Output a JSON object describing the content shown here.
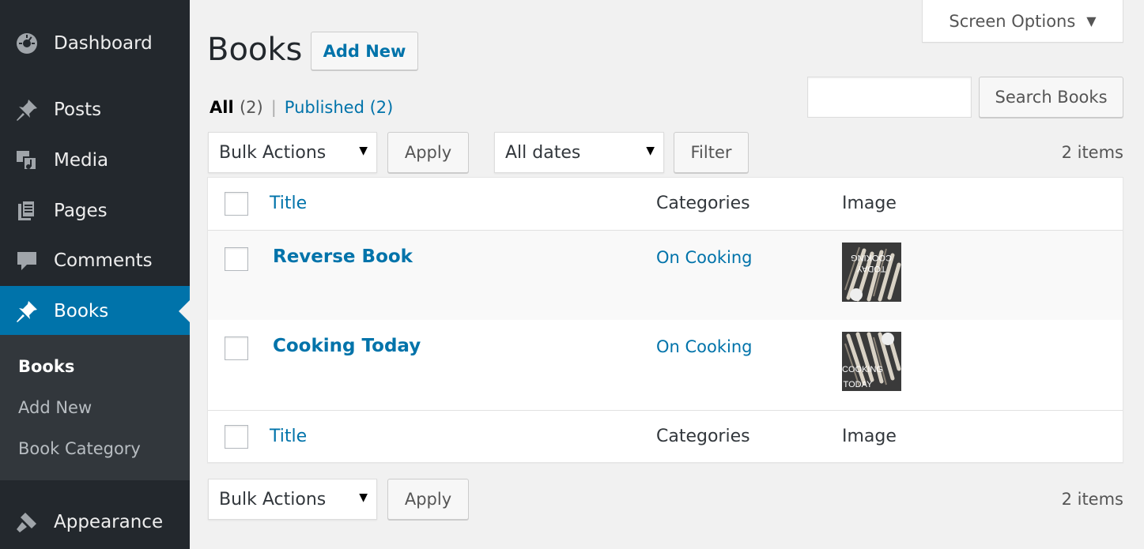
{
  "sidebar": {
    "items": [
      {
        "label": "Dashboard",
        "icon": "dashboard-icon"
      },
      {
        "label": "Posts",
        "icon": "pin-icon"
      },
      {
        "label": "Media",
        "icon": "media-icon"
      },
      {
        "label": "Pages",
        "icon": "pages-icon"
      },
      {
        "label": "Comments",
        "icon": "comment-icon"
      },
      {
        "label": "Books",
        "icon": "pin-icon"
      },
      {
        "label": "Appearance",
        "icon": "brush-icon"
      }
    ],
    "submenu": [
      {
        "label": "Books"
      },
      {
        "label": "Add New"
      },
      {
        "label": "Book Category"
      }
    ]
  },
  "screen_options": {
    "label": "Screen Options",
    "caret": "▼"
  },
  "header": {
    "title": "Books",
    "add_new": "Add New"
  },
  "views": {
    "all_label": "All",
    "all_count": "(2)",
    "separator": "|",
    "published_label": "Published",
    "published_count": "(2)"
  },
  "search": {
    "placeholder": "",
    "button": "Search Books"
  },
  "top_nav": {
    "bulk_actions": "Bulk Actions",
    "apply": "Apply",
    "dates": "All dates",
    "filter": "Filter",
    "items_count": "2 items"
  },
  "table": {
    "columns": {
      "title": "Title",
      "categories": "Categories",
      "image": "Image"
    },
    "rows": [
      {
        "title": "Reverse Book",
        "category": "On Cooking",
        "image_text_1": "TODAY",
        "image_text_2": "COOKING"
      },
      {
        "title": "Cooking Today",
        "category": "On Cooking",
        "image_text_1": "COOKING",
        "image_text_2": "TODAY"
      }
    ]
  },
  "bottom_nav": {
    "bulk_actions": "Bulk Actions",
    "apply": "Apply",
    "items_count": "2 items"
  },
  "colors": {
    "sidebar_bg": "#23282d",
    "accent": "#0073aa",
    "page_bg": "#f1f1f1"
  }
}
